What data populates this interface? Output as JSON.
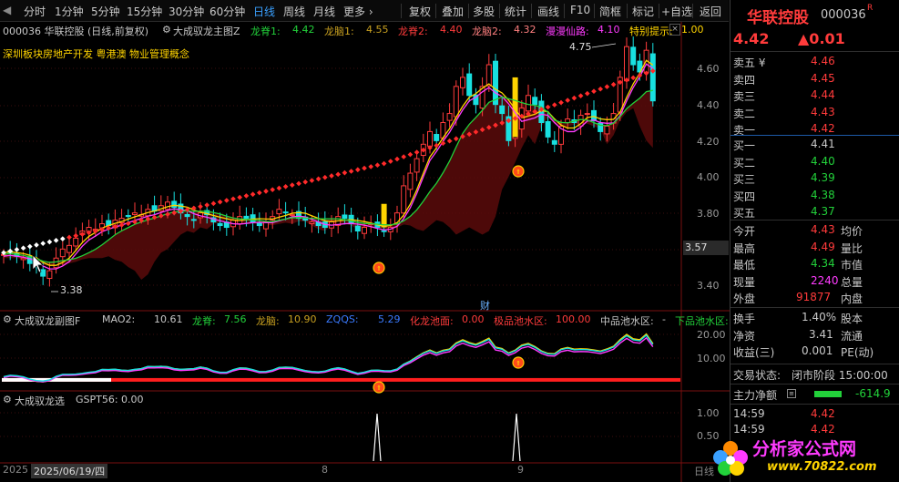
{
  "toolbar": {
    "items": [
      "分时",
      "1分钟",
      "5分钟",
      "15分钟",
      "30分钟",
      "60分钟",
      "日线",
      "周线",
      "月线",
      "更多 ›"
    ],
    "right_items": [
      "复权",
      "叠加",
      "多股",
      "统计",
      "画线",
      "F10",
      "简框",
      "标记",
      "+自选",
      "返回"
    ],
    "active": "日线"
  },
  "main_header": {
    "stock_line": "000036  华联控股 (日线,前复权)",
    "indicator_name": "大成驭龙主图Z",
    "items": [
      {
        "label": "龙脊1:",
        "value": "4.42",
        "color": "#22d13a"
      },
      {
        "label": "龙脑1:",
        "value": "4.55",
        "color": "#c8a020"
      },
      {
        "label": "龙脊2:",
        "value": "4.40",
        "color": "#ff3b3b"
      },
      {
        "label": "龙脑2:",
        "value": "4.32",
        "color": "#ff7f7f"
      },
      {
        "label": "漫漫仙路:",
        "value": "4.10",
        "color": "#ff3bff"
      },
      {
        "label": "特别提示:",
        "value": "1.00",
        "color": "#ffd400"
      }
    ],
    "concepts": "深圳板块房地产开发 粤港澳  物业管理概念",
    "annot_high": "4.75",
    "annot_low": "3.38",
    "cur_price_tag": "3.57",
    "cai_tag": "财"
  },
  "y_axis_main": [
    "4.60",
    "4.40",
    "4.20",
    "4.00",
    "3.80",
    "3.60",
    "3.40"
  ],
  "sub1_header": {
    "name": "大成驭龙副图F",
    "items": [
      {
        "label": "MAO2:",
        "value": "10.61",
        "color": "#c8c8c8"
      },
      {
        "label": "龙脊:",
        "value": "7.56",
        "color": "#22d13a"
      },
      {
        "label": "龙脑:",
        "value": "10.90",
        "color": "#c8a020"
      },
      {
        "label": "ZQQS:",
        "value": "5.29",
        "color": "#3a7aff"
      },
      {
        "label": "化龙池面:",
        "value": "0.00",
        "color": "#ff3b3b"
      },
      {
        "label": "极品池水区:",
        "value": "100.00",
        "color": "#ff3b3b"
      },
      {
        "label": "中品池水区:",
        "value": "-",
        "color": "#c8c8c8"
      },
      {
        "label": "下品池水区:",
        "value": "-",
        "color": "#22d13a"
      }
    ]
  },
  "y_axis_sub1": [
    "20.00",
    "10.00"
  ],
  "sub2_header": {
    "name": "大成驭龙选",
    "items": [
      {
        "label": "GSPT56:",
        "value": "0.00",
        "color": "#c8c8c8"
      }
    ]
  },
  "y_axis_sub2": [
    "1.00",
    "0.50"
  ],
  "x_axis": {
    "left_date": "2025/06/19/四",
    "left_prefix": "2025",
    "tick_8": "8",
    "tick_9": "9",
    "right": "日线"
  },
  "panel": {
    "name": "华联控股",
    "code": "000036",
    "r_tag": "R",
    "price": "4.42",
    "change": "▲0.01",
    "asks": [
      {
        "label": "卖五 ¥",
        "price": "4.46"
      },
      {
        "label": "卖四",
        "price": "4.45"
      },
      {
        "label": "卖三",
        "price": "4.44"
      },
      {
        "label": "卖二",
        "price": "4.43"
      },
      {
        "label": "卖一",
        "price": "4.42"
      }
    ],
    "bids": [
      {
        "label": "买一",
        "price": "4.41"
      },
      {
        "label": "买二",
        "price": "4.40"
      },
      {
        "label": "买三",
        "price": "4.39"
      },
      {
        "label": "买四",
        "price": "4.38"
      },
      {
        "label": "买五",
        "price": "4.37"
      }
    ],
    "stats": [
      {
        "l1": "今开",
        "v1": "4.43",
        "c1": "red",
        "l2": "均价"
      },
      {
        "l1": "最高",
        "v1": "4.49",
        "c1": "red",
        "l2": "量比"
      },
      {
        "l1": "最低",
        "v1": "4.34",
        "c1": "green",
        "l2": "市值"
      },
      {
        "l1": "现量",
        "v1": "2240",
        "c1": "mag",
        "l2": "总量"
      },
      {
        "l1": "外盘",
        "v1": "91877",
        "c1": "red",
        "l2": "内盘"
      }
    ],
    "stats2": [
      {
        "l1": "换手",
        "v1": "1.40%",
        "l2": "股本"
      },
      {
        "l1": "净资",
        "v1": "3.41",
        "l2": "流通"
      },
      {
        "l1": "收益(三)",
        "v1": "0.001",
        "l2": "PE(动)"
      }
    ],
    "trade_state_label": "交易状态:",
    "trade_state_value": "闭市阶段 15:00:00",
    "main_net_label": "主力净额",
    "main_net_value": "-614.9",
    "ticks": [
      {
        "time": "14:59",
        "price": "4.42"
      },
      {
        "time": "14:59",
        "price": "4.42"
      }
    ]
  },
  "watermark": {
    "text": "分析家公式网",
    "url": "www.70822.com"
  },
  "colors": {
    "up": "#ff3b3b",
    "down": "#22e0e0",
    "ma_green": "#22d13a",
    "ma_magenta": "#ff3bff",
    "ma_yellow": "#ffd400"
  }
}
